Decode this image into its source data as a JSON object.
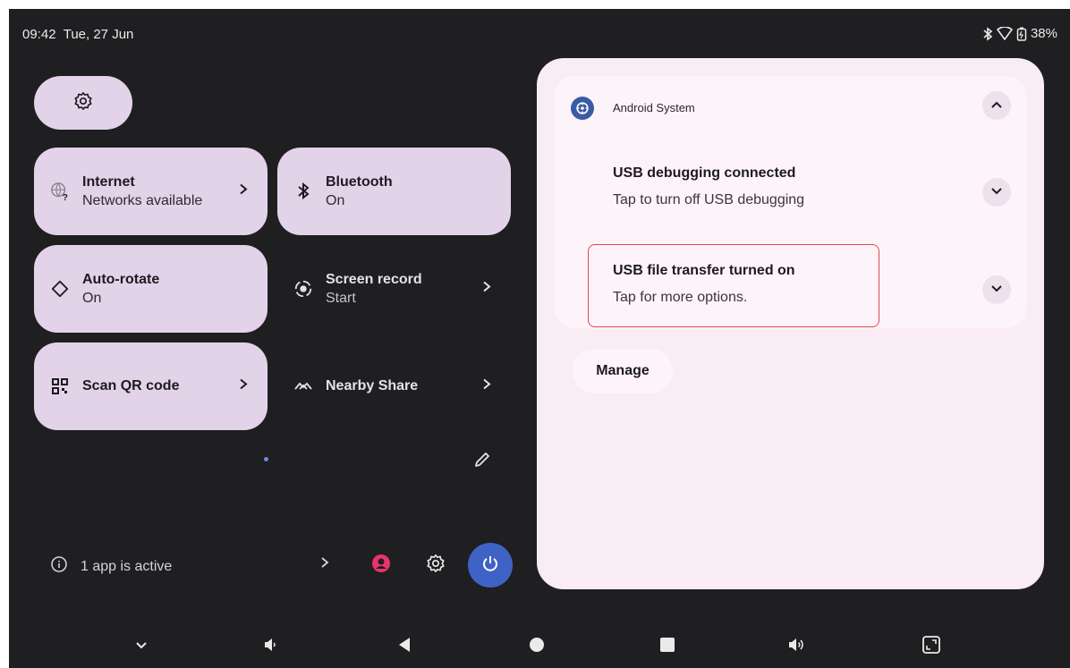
{
  "status_bar": {
    "time": "09:42",
    "date": "Tue, 27 Jun",
    "battery": "38%",
    "icons": [
      "bluetooth-icon",
      "wifi-icon",
      "battery-icon"
    ]
  },
  "quick_settings": {
    "settings_icon": "gear-icon",
    "tiles": [
      {
        "title": "Internet",
        "subtitle": "Networks available",
        "icon": "globe-question-icon",
        "state": "on"
      },
      {
        "title": "Bluetooth",
        "subtitle": "On",
        "icon": "bluetooth-icon",
        "state": "on"
      },
      {
        "title": "Auto-rotate",
        "subtitle": "On",
        "icon": "rotate-icon",
        "state": "on"
      },
      {
        "title": "Screen record",
        "subtitle": "Start",
        "icon": "record-icon",
        "state": "off"
      },
      {
        "title": "Scan QR code",
        "subtitle": "",
        "icon": "qr-icon",
        "state": "on"
      },
      {
        "title": "Nearby Share",
        "subtitle": "",
        "icon": "nearby-share-icon",
        "state": "off"
      }
    ],
    "footer": {
      "active_apps": "1 app is active"
    }
  },
  "notifications": {
    "app_name": "Android System",
    "items": [
      {
        "title": "USB debugging connected",
        "text": "Tap to turn off USB debugging"
      },
      {
        "title": "USB file transfer turned on",
        "text": "Tap for more options."
      }
    ],
    "manage_label": "Manage"
  },
  "colors": {
    "background": "#1f1f21",
    "tile_on": "#e3d3e8",
    "panel": "#f9ecf3",
    "power_button": "#3f63c4",
    "highlight": "#e04848",
    "user_icon": "#e8336b"
  }
}
